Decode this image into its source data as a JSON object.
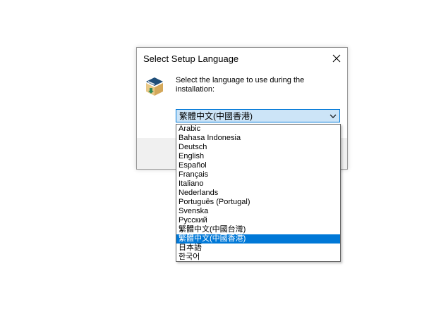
{
  "dialog": {
    "title": "Select Setup Language",
    "prompt": "Select the language to use during the installation:",
    "selected_language": "繁體中文(中國香港)"
  },
  "icons": {
    "close": "close-icon",
    "setup": "setup-package-icon",
    "dropdown_arrow": "chevron-down-icon"
  },
  "dropdown": {
    "options": [
      "Arabic",
      "Bahasa Indonesia",
      "Deutsch",
      "English",
      "Español",
      "Français",
      "Italiano",
      "Nederlands",
      "Português (Portugal)",
      "Svenska",
      "Русский",
      "繁體中文(中國台灣)",
      "繁體中文(中國香港)",
      "日本語",
      "한국어"
    ],
    "highlighted_index": 12
  },
  "colors": {
    "accent": "#0078d7",
    "combo_background": "#cce4f7",
    "dialog_background": "#f0f0f0"
  }
}
